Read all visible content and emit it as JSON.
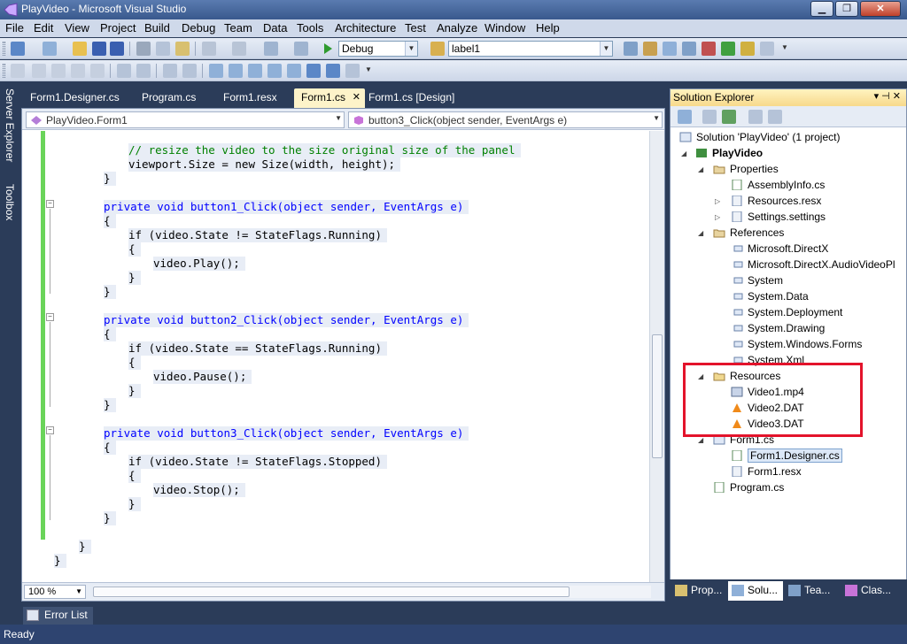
{
  "window": {
    "title": "PlayVideo - Microsoft Visual Studio"
  },
  "menu": [
    "File",
    "Edit",
    "View",
    "Project",
    "Build",
    "Debug",
    "Team",
    "Data",
    "Tools",
    "Architecture",
    "Test",
    "Analyze",
    "Window",
    "Help"
  ],
  "toolbar": {
    "config": "Debug",
    "find_target": "label1"
  },
  "side_tabs": [
    "Server Explorer",
    "Toolbox"
  ],
  "doc_tabs": [
    {
      "label": "Form1.Designer.cs",
      "active": false
    },
    {
      "label": "Program.cs",
      "active": false
    },
    {
      "label": "Form1.resx",
      "active": false
    },
    {
      "label": "Form1.cs",
      "active": true
    },
    {
      "label": "Form1.cs [Design]",
      "active": false
    }
  ],
  "editor": {
    "type_nav": "PlayVideo.Form1",
    "member_nav": "button3_Click(object sender, EventArgs e)",
    "zoom": "100 %"
  },
  "code_lines": [
    "// resize the video to the size original size of the panel",
    "viewport.Size = new Size(width, height);",
    "}",
    "private void button1_Click(object sender, EventArgs e)",
    "{",
    "if (video.State != StateFlags.Running)",
    "{",
    "video.Play();",
    "}",
    "}",
    "private void button2_Click(object sender, EventArgs e)",
    "{",
    "if (video.State == StateFlags.Running)",
    "{",
    "video.Pause();",
    "}",
    "}",
    "private void button3_Click(object sender, EventArgs e)",
    "{",
    "if (video.State != StateFlags.Stopped)",
    "{",
    "video.Stop();",
    "}",
    "}",
    "}",
    "}"
  ],
  "solution_explorer": {
    "title": "Solution Explorer",
    "items": [
      "Solution 'PlayVideo' (1 project)",
      "PlayVideo",
      "Properties",
      "AssemblyInfo.cs",
      "Resources.resx",
      "Settings.settings",
      "References",
      "Microsoft.DirectX",
      "Microsoft.DirectX.AudioVideoPl",
      "System",
      "System.Data",
      "System.Deployment",
      "System.Drawing",
      "System.Windows.Forms",
      "System.Xml",
      "Resources",
      "Video1.mp4",
      "Video2.DAT",
      "Video3.DAT",
      "Form1.cs",
      "Form1.Designer.cs",
      "Form1.resx",
      "Program.cs"
    ]
  },
  "bottom_tabs": [
    "Prop...",
    "Solu...",
    "Tea...",
    "Clas..."
  ],
  "error_list": "Error List",
  "status": "Ready",
  "colors": {
    "highlight_box": "#e3132b",
    "active_tab": "#fdf3c9",
    "ide_frame": "#2b3c59"
  }
}
